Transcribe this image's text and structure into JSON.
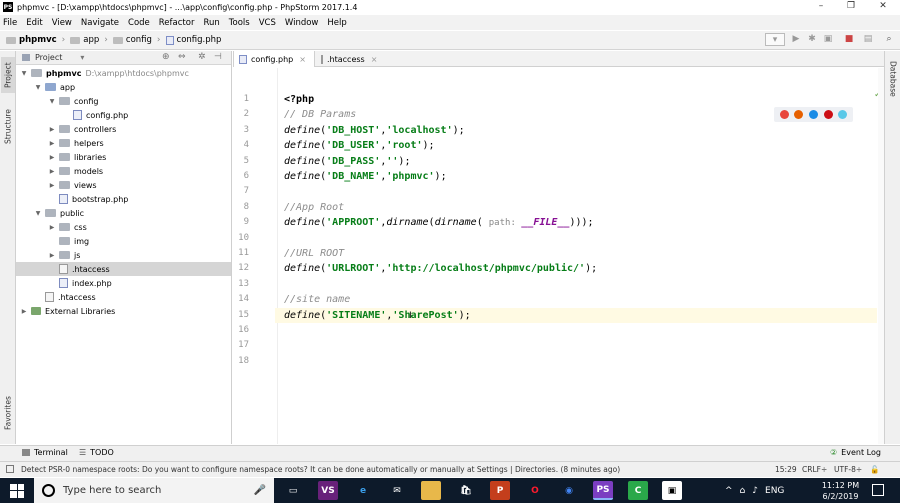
{
  "window": {
    "title": "phpmvc - [D:\\xampp\\htdocs\\phpmvc] - ...\\app\\config\\config.php - PhpStorm 2017.1.4",
    "app_icon": "PS"
  },
  "menu": [
    "File",
    "Edit",
    "View",
    "Navigate",
    "Code",
    "Refactor",
    "Run",
    "Tools",
    "VCS",
    "Window",
    "Help"
  ],
  "breadcrumb": [
    "phpmvc",
    "app",
    "config",
    "config.php"
  ],
  "project_panel": {
    "title": "Project",
    "tree": [
      {
        "label": "phpmvc",
        "path": "D:\\xampp\\htdocs\\phpmvc",
        "kind": "folder",
        "depth": 0,
        "expanded": true
      },
      {
        "label": "app",
        "path": "",
        "kind": "folder",
        "depth": 1,
        "expanded": true
      },
      {
        "label": "config",
        "path": "",
        "kind": "folder",
        "depth": 2,
        "expanded": true
      },
      {
        "label": "config.php",
        "path": "",
        "kind": "php",
        "depth": 3,
        "expanded": null
      },
      {
        "label": "controllers",
        "path": "",
        "kind": "folder",
        "depth": 2,
        "expanded": false
      },
      {
        "label": "helpers",
        "path": "",
        "kind": "folder",
        "depth": 2,
        "expanded": false
      },
      {
        "label": "libraries",
        "path": "",
        "kind": "folder",
        "depth": 2,
        "expanded": false
      },
      {
        "label": "models",
        "path": "",
        "kind": "folder",
        "depth": 2,
        "expanded": false
      },
      {
        "label": "views",
        "path": "",
        "kind": "folder",
        "depth": 2,
        "expanded": false
      },
      {
        "label": "bootstrap.php",
        "path": "",
        "kind": "php",
        "depth": 2,
        "expanded": null
      },
      {
        "label": "public",
        "path": "",
        "kind": "folder",
        "depth": 1,
        "expanded": true
      },
      {
        "label": "css",
        "path": "",
        "kind": "folder",
        "depth": 2,
        "expanded": false
      },
      {
        "label": "img",
        "path": "",
        "kind": "folder",
        "depth": 2,
        "expanded": null
      },
      {
        "label": "js",
        "path": "",
        "kind": "folder",
        "depth": 2,
        "expanded": false
      },
      {
        "label": ".htaccess",
        "path": "",
        "kind": "htaccess",
        "depth": 2,
        "expanded": null,
        "selected": true
      },
      {
        "label": "index.php",
        "path": "",
        "kind": "php",
        "depth": 2,
        "expanded": null
      },
      {
        "label": ".htaccess",
        "path": "",
        "kind": "htaccess",
        "depth": 1,
        "expanded": null
      },
      {
        "label": "External Libraries",
        "path": "",
        "kind": "lib",
        "depth": 0,
        "expanded": false
      }
    ]
  },
  "side_tabs": {
    "left": [
      "Project",
      "Structure",
      "Favorites"
    ],
    "right": [
      "Database"
    ]
  },
  "editor_tabs": [
    {
      "label": "config.php",
      "active": true
    },
    {
      "label": ".htaccess",
      "active": false
    }
  ],
  "code": {
    "line_numbers": [
      "1",
      "2",
      "3",
      "4",
      "5",
      "6",
      "7",
      "8",
      "9",
      "10",
      "11",
      "12",
      "13",
      "14",
      "15",
      "16",
      "17",
      "18"
    ],
    "current_line": 15,
    "lines": [
      [
        {
          "t": "<?php",
          "c": "pt"
        }
      ],
      [
        {
          "t": "// DB Params",
          "c": "cmt"
        }
      ],
      [
        {
          "t": "define",
          "c": "kw"
        },
        {
          "t": "(",
          "c": ""
        },
        {
          "t": "'DB_HOST'",
          "c": "str"
        },
        {
          "t": ",",
          "c": ""
        },
        {
          "t": "'localhost'",
          "c": "str"
        },
        {
          "t": ");",
          "c": ""
        }
      ],
      [
        {
          "t": "define",
          "c": "kw"
        },
        {
          "t": "(",
          "c": ""
        },
        {
          "t": "'DB_USER'",
          "c": "str"
        },
        {
          "t": ",",
          "c": ""
        },
        {
          "t": "'root'",
          "c": "str"
        },
        {
          "t": ");",
          "c": ""
        }
      ],
      [
        {
          "t": "define",
          "c": "kw"
        },
        {
          "t": "(",
          "c": ""
        },
        {
          "t": "'DB_PASS'",
          "c": "str"
        },
        {
          "t": ",",
          "c": ""
        },
        {
          "t": "''",
          "c": "str"
        },
        {
          "t": ");",
          "c": ""
        }
      ],
      [
        {
          "t": "define",
          "c": "kw"
        },
        {
          "t": "(",
          "c": ""
        },
        {
          "t": "'DB_NAME'",
          "c": "str"
        },
        {
          "t": ",",
          "c": ""
        },
        {
          "t": "'phpmvc'",
          "c": "str"
        },
        {
          "t": ");",
          "c": ""
        }
      ],
      [],
      [
        {
          "t": "//App Root",
          "c": "cmt"
        }
      ],
      [
        {
          "t": "define",
          "c": "kw"
        },
        {
          "t": "(",
          "c": ""
        },
        {
          "t": "'APPROOT'",
          "c": "str"
        },
        {
          "t": ",",
          "c": ""
        },
        {
          "t": "dirname",
          "c": "kw"
        },
        {
          "t": "(",
          "c": ""
        },
        {
          "t": "dirname",
          "c": "kw"
        },
        {
          "t": "( ",
          "c": ""
        },
        {
          "t": "path: ",
          "c": "hint"
        },
        {
          "t": "__FILE__",
          "c": "const"
        },
        {
          "t": ")));",
          "c": ""
        }
      ],
      [],
      [
        {
          "t": "//URL ROOT",
          "c": "cmt"
        }
      ],
      [
        {
          "t": "define",
          "c": "kw"
        },
        {
          "t": "(",
          "c": ""
        },
        {
          "t": "'URLROOT'",
          "c": "str"
        },
        {
          "t": ",",
          "c": ""
        },
        {
          "t": "'http://localhost/phpmvc/public/'",
          "c": "str"
        },
        {
          "t": ");",
          "c": ""
        }
      ],
      [],
      [
        {
          "t": "//site name",
          "c": "cmt"
        }
      ],
      [
        {
          "t": "define",
          "c": "kw"
        },
        {
          "t": "(",
          "c": ""
        },
        {
          "t": "'SITENAME'",
          "c": "str"
        },
        {
          "t": ",",
          "c": ""
        },
        {
          "t": "'SharePost'",
          "c": "str"
        },
        {
          "t": ");",
          "c": ""
        }
      ],
      [],
      [],
      []
    ]
  },
  "browser_icons": [
    {
      "name": "chrome-icon",
      "color": "#e8453c"
    },
    {
      "name": "firefox-icon",
      "color": "#e66000"
    },
    {
      "name": "safari-icon",
      "color": "#1a8ce6"
    },
    {
      "name": "opera-icon",
      "color": "#cc0f16"
    },
    {
      "name": "edge-icon",
      "color": "#5ac8e8"
    }
  ],
  "bottom_tools": {
    "terminal": "Terminal",
    "todo": "TODO",
    "event_log": "Event Log"
  },
  "status": {
    "message": "Detect PSR-0 namespace roots: Do you want to configure namespace roots? It can be done automatically or manually at Settings | Directories. (8 minutes ago)",
    "position": "15:29",
    "line_sep": "CRLF÷",
    "encoding": "UTF-8÷"
  },
  "taskbar": {
    "search_placeholder": "Type here to search",
    "apps": [
      {
        "name": "task-view",
        "bg": "#0d1a2a",
        "fg": "#fff",
        "glyph": "▭"
      },
      {
        "name": "visual-studio",
        "bg": "#68217a",
        "fg": "#fff",
        "glyph": "VS"
      },
      {
        "name": "edge",
        "bg": "#0d1a2a",
        "fg": "#3b9ee8",
        "glyph": "e"
      },
      {
        "name": "mail",
        "bg": "#0d1a2a",
        "fg": "#fff",
        "glyph": "✉"
      },
      {
        "name": "file-explorer",
        "bg": "#e8b84a",
        "fg": "#fff",
        "glyph": ""
      },
      {
        "name": "store",
        "bg": "#0d1a2a",
        "fg": "#fff",
        "glyph": "🛍"
      },
      {
        "name": "powerpoint",
        "bg": "#c43e1c",
        "fg": "#fff",
        "glyph": "P"
      },
      {
        "name": "opera",
        "bg": "#0d1a2a",
        "fg": "#ff1b2d",
        "glyph": "O"
      },
      {
        "name": "chrome",
        "bg": "#0d1a2a",
        "fg": "#4285f4",
        "glyph": "◉"
      },
      {
        "name": "phpstorm",
        "bg": "#7b3ec1",
        "fg": "#fff",
        "glyph": "PS",
        "active": true
      },
      {
        "name": "camtasia",
        "bg": "#2aa84a",
        "fg": "#fff",
        "glyph": "C"
      },
      {
        "name": "app-black",
        "bg": "#fff",
        "fg": "#000",
        "glyph": "▣"
      }
    ],
    "tray": {
      "language": "ENG"
    },
    "time": "11:12 PM",
    "date": "6/2/2019"
  }
}
